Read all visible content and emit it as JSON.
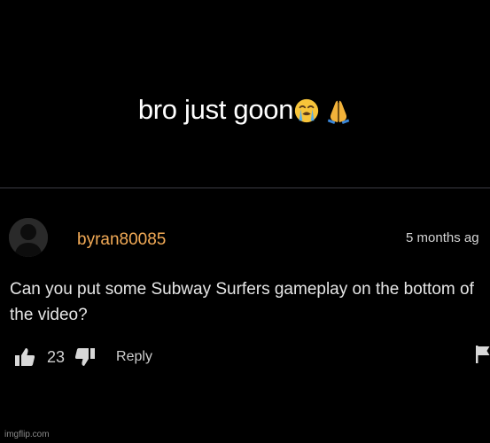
{
  "meme": {
    "caption": "bro just goon",
    "emojis": [
      "loudly-crying-face-icon",
      "folded-hands-icon"
    ]
  },
  "comment": {
    "username": "byran80085",
    "timestamp": "5 months ag",
    "text": "Can you put some Subway Surfers gameplay on the bottom of the video?",
    "like_count": "23",
    "reply_label": "Reply"
  },
  "watermark": "imgflip.com",
  "colors": {
    "background": "#000000",
    "username": "#f2aa56",
    "comment_text": "#e6e6e6",
    "meta_text": "#cfcfcf"
  }
}
